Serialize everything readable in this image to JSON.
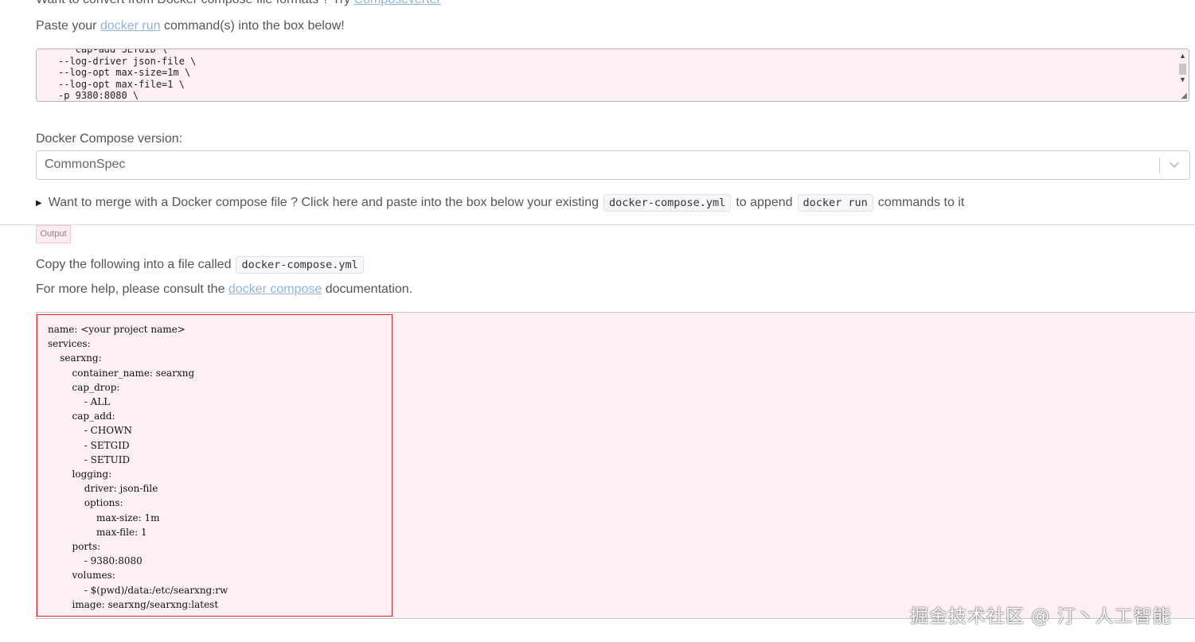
{
  "intro": {
    "text_before": "Want to convert from Docker compose file formats ? Try ",
    "link": "Composeverter"
  },
  "paste": {
    "before": "Paste your ",
    "link": "docker run",
    "after": " command(s) into the box below!"
  },
  "input_textarea": {
    "lines": "   cap-add SETUID \\\n--log-driver json-file \\\n--log-opt max-size=1m \\\n--log-opt max-file=1 \\\n-p 9380:8080 \\"
  },
  "version": {
    "label": "Docker Compose version:",
    "selected": "CommonSpec"
  },
  "merge": {
    "text_before": "Want to merge with a Docker compose file ? Click here and paste into the box below your existing",
    "code1": "docker-compose.yml",
    "text_middle": "to append",
    "code2": "docker run",
    "text_after": "commands to it"
  },
  "output_tag": "Output",
  "copy": {
    "text": "Copy the following into a file called",
    "code": "docker-compose.yml"
  },
  "help": {
    "before": "For more help, please consult the ",
    "link": "docker compose",
    "after": " documentation."
  },
  "output_yaml": "name: <your project name>\nservices:\n    searxng:\n        container_name: searxng\n        cap_drop:\n            - ALL\n        cap_add:\n            - CHOWN\n            - SETGID\n            - SETUID\n        logging:\n            driver: json-file\n            options:\n                max-size: 1m\n                max-file: 1\n        ports:\n            - 9380:8080\n        volumes:\n            - $(pwd)/data:/etc/searxng:rw\n        image: searxng/searxng:latest",
  "watermark": "掘金技术社区 @ 汀丶人工智能",
  "colors": {
    "link": "#8fb3df",
    "panel_bg": "#fdf0f2",
    "highlight_border": "#e02424"
  }
}
